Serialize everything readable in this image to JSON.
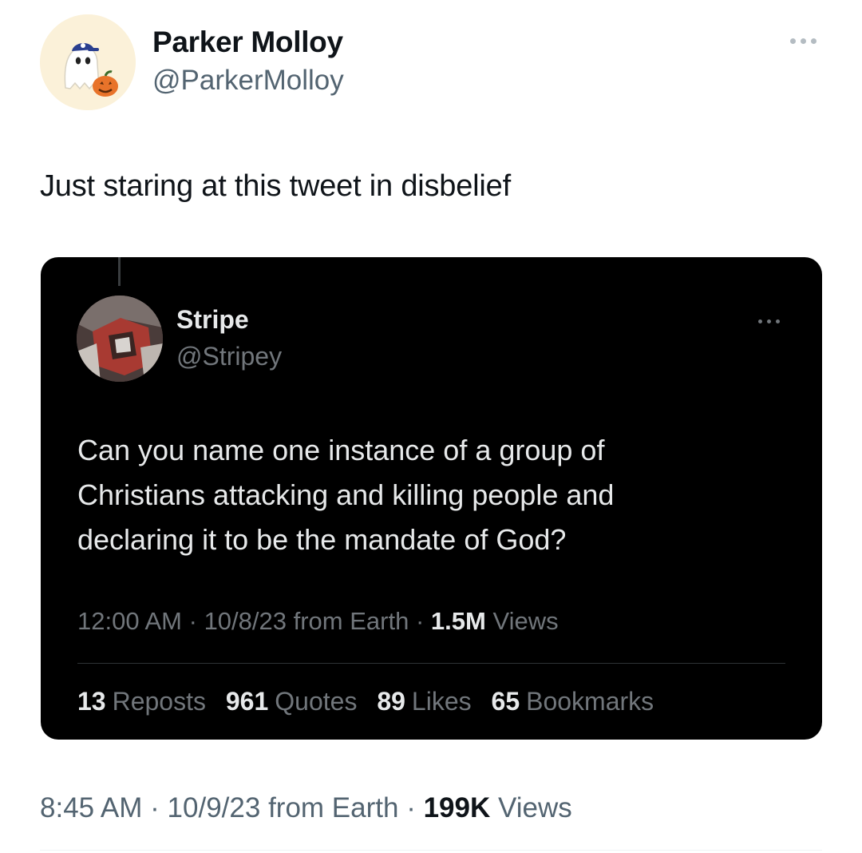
{
  "outer_tweet": {
    "display_name": "Parker Molloy",
    "handle": "@ParkerMolloy",
    "avatar_icon": "ghost-pumpkin-avatar",
    "more_icon": "more-options-icon",
    "text": "Just staring at this tweet in disbelief",
    "meta": {
      "time": "8:45 AM",
      "date": "10/9/23",
      "source": "from Earth",
      "separator": "·",
      "views_count": "199K",
      "views_label": "Views"
    }
  },
  "quoted_tweet": {
    "display_name": "Stripe",
    "handle": "@Stripey",
    "avatar_icon": "robot-figure-avatar",
    "more_icon": "more-options-icon",
    "text_lines": [
      "Can you name one instance of a group of",
      "Christians attacking and killing people and",
      "declaring it to be the mandate of God?"
    ],
    "meta": {
      "time": "12:00 AM",
      "date": "10/8/23",
      "source": "from Earth",
      "separator": "·",
      "views_count": "1.5M",
      "views_label": "Views"
    },
    "stats": [
      {
        "count": "13",
        "label": "Reposts"
      },
      {
        "count": "961",
        "label": "Quotes"
      },
      {
        "count": "89",
        "label": "Likes"
      },
      {
        "count": "65",
        "label": "Bookmarks"
      }
    ]
  },
  "colors": {
    "background": "#ffffff",
    "card_background": "#000000",
    "primary_text": "#0f1419",
    "secondary_text": "#536471",
    "dark_primary_text": "#e7e9ea",
    "dark_secondary_text": "#71767b"
  }
}
